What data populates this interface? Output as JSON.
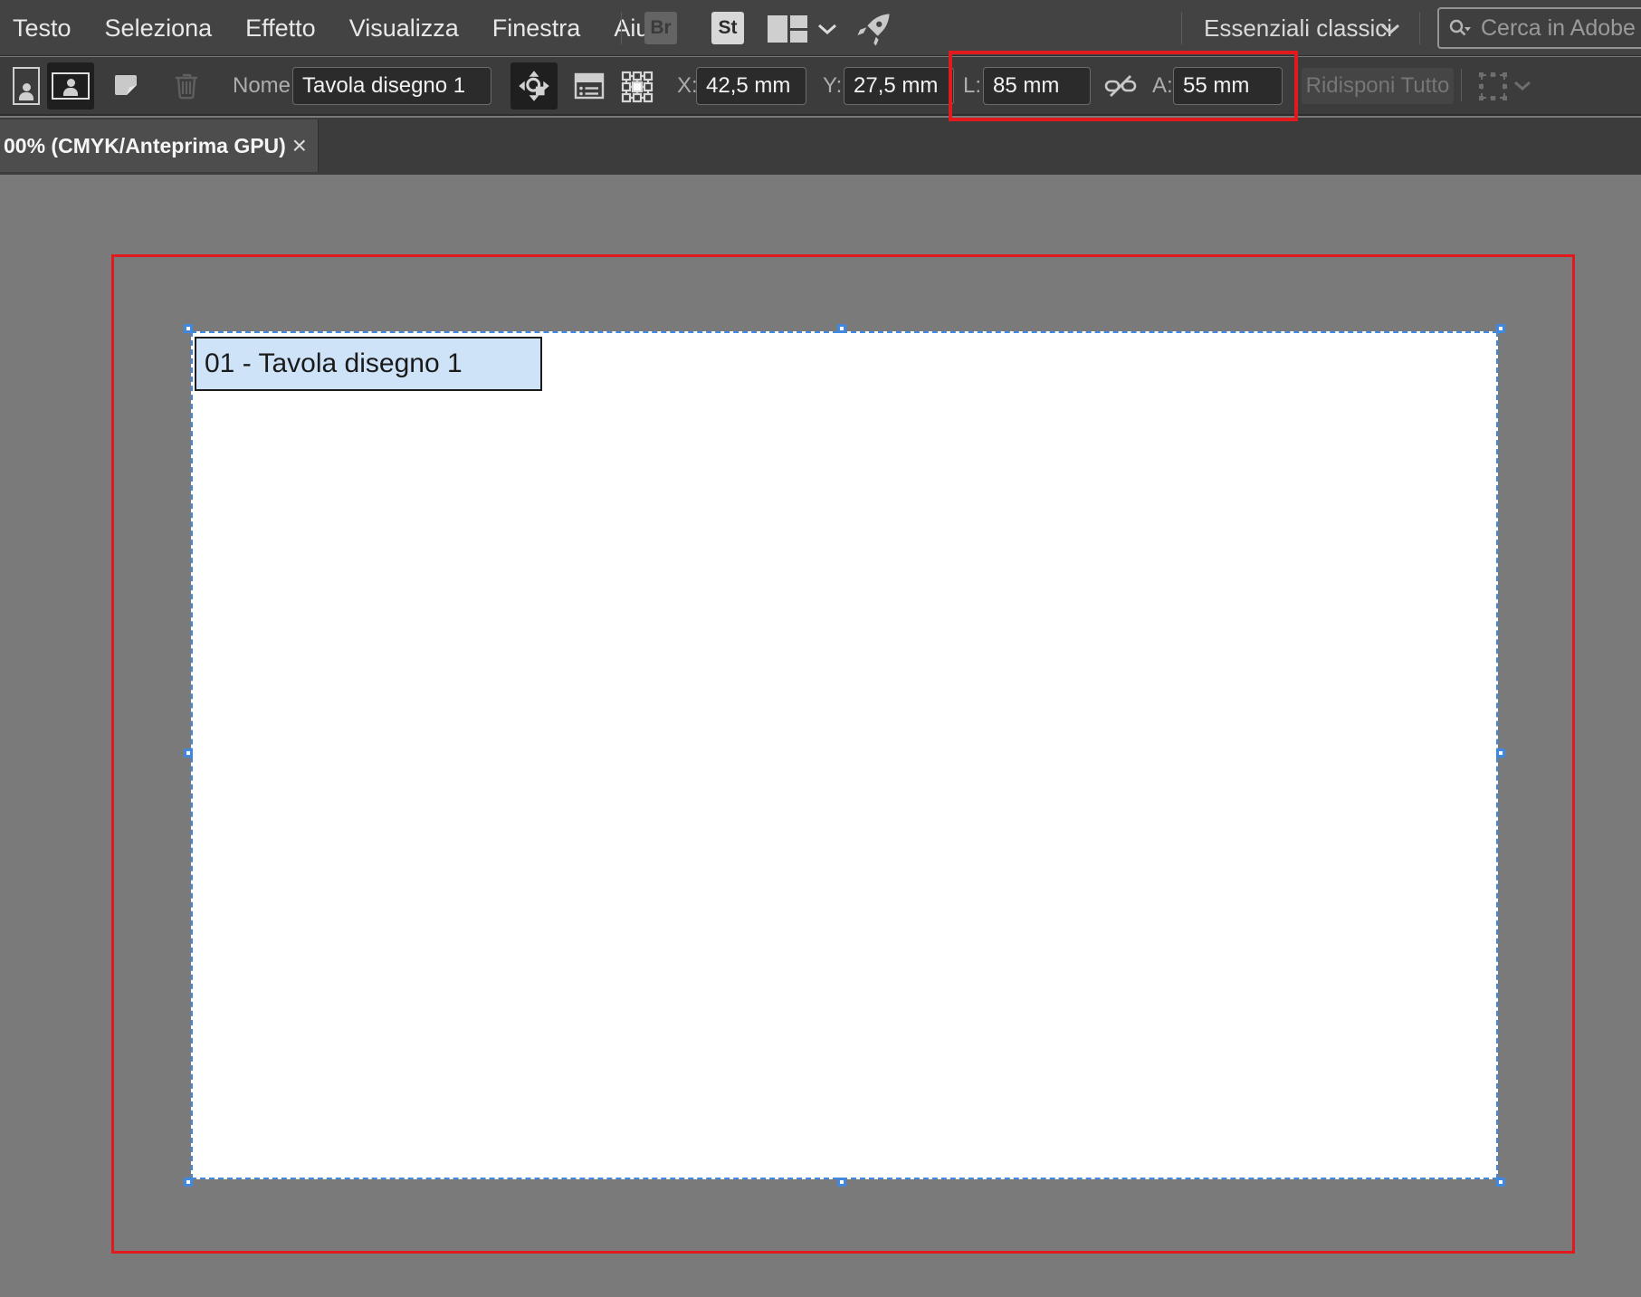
{
  "menu_bar": {
    "items": [
      "Testo",
      "Seleziona",
      "Effetto",
      "Visualizza",
      "Finestra",
      "Aiuto"
    ],
    "bridge_badge": "Br",
    "stock_badge": "St",
    "workspace_label": "Essenziali classici",
    "search_placeholder": "Cerca in Adobe Sto"
  },
  "control_bar": {
    "name_label": "Nome:",
    "name_value": "Tavola disegno 1",
    "x_label": "X:",
    "x_value": "42,5 mm",
    "y_label": "Y:",
    "y_value": "27,5 mm",
    "width_label": "L:",
    "width_value": "85 mm",
    "height_label": "A:",
    "height_value": "55 mm",
    "rearrange_all_label": "Ridisponi Tutto"
  },
  "document_tab": {
    "title": "00% (CMYK/Anteprima GPU)",
    "close_glyph": "×"
  },
  "canvas": {
    "artboard_label": "01 - Tavola disegno 1"
  },
  "colors": {
    "annotation_red": "#e2191d",
    "selection_blue": "#3f8ae0",
    "artboard_label_bg": "#cfe3f8",
    "canvas_gray": "#7a7a7a",
    "artboard_white": "#ffffff"
  }
}
